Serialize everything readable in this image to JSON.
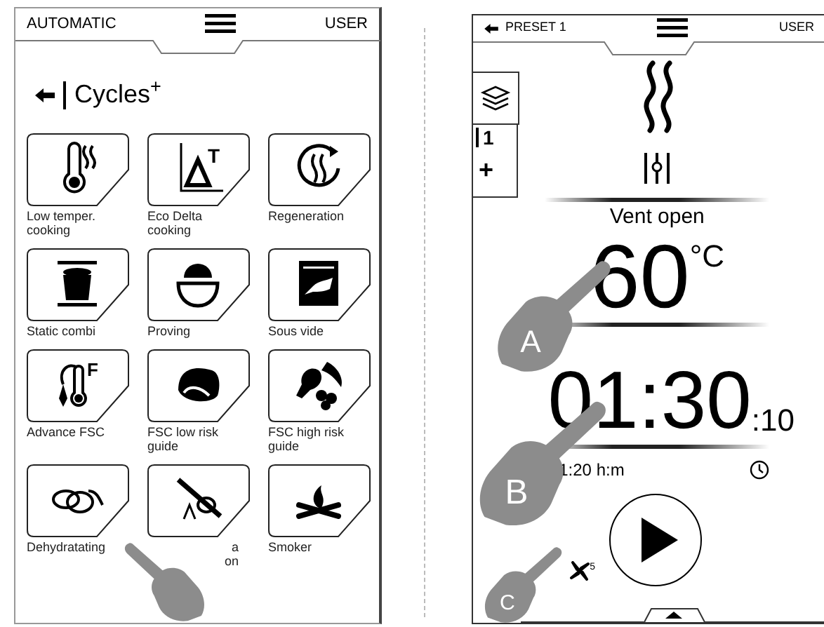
{
  "left_screen": {
    "header": {
      "mode": "AUTOMATIC",
      "user": "USER"
    },
    "title": "Cycles$^{+}$",
    "tiles": [
      {
        "lines": [
          "Low temper.",
          "cooking"
        ]
      },
      {
        "lines": [
          "Eco Delta",
          "cooking"
        ],
        "icon_text": "T"
      },
      {
        "lines": [
          "Regeneration"
        ]
      },
      {
        "lines": [
          "Static combi"
        ]
      },
      {
        "lines": [
          "Proving"
        ]
      },
      {
        "lines": [
          "Sous vide"
        ]
      },
      {
        "lines": [
          "Advance FSC"
        ],
        "icon_text": "F"
      },
      {
        "lines": [
          "FSC low risk",
          "guide"
        ]
      },
      {
        "lines": [
          "FSC high risk",
          "guide"
        ]
      },
      {
        "lines": [
          "Dehydratating"
        ]
      },
      {
        "lines": [
          "a",
          "on"
        ],
        "partly_covered": true
      },
      {
        "lines": [
          "Smoker"
        ]
      }
    ]
  },
  "right_screen": {
    "header": {
      "preset": "PRESET 1",
      "user": "USER"
    },
    "side_tab": {
      "level_label": "1",
      "add": "+"
    },
    "vent_status": "Vent open",
    "temperature": "60",
    "temperature_unit": "°C",
    "time": "01:30",
    "time_seconds": ":10",
    "elapsed": "1:20 h:m",
    "fan_speed": "5"
  },
  "pointers": [
    {
      "kind": "plain"
    },
    {
      "kind": "lettered",
      "label": "A"
    },
    {
      "kind": "lettered",
      "label": "B"
    },
    {
      "kind": "lettered",
      "label": "C"
    }
  ]
}
